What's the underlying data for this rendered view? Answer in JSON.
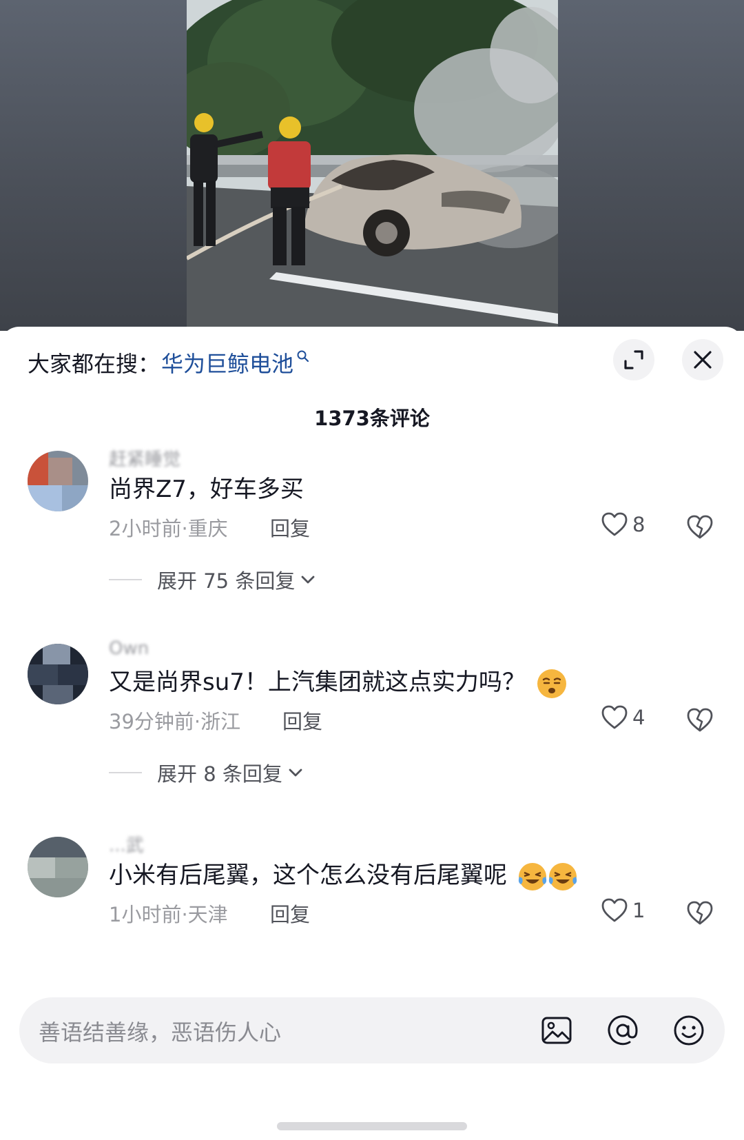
{
  "video": {
    "background_color": "#50555e"
  },
  "search": {
    "prefix": "大家都在搜：",
    "term": "华为巨鲸电池",
    "icon": "search-icon"
  },
  "header": {
    "expand_icon": "expand-icon",
    "close_icon": "close-icon"
  },
  "comments_count_title": "1373条评论",
  "comments": [
    {
      "username": "赶紧睡觉",
      "text": "尚界Z7，好车多买",
      "time_location": "2小时前·重庆",
      "reply_label": "回复",
      "likes": "8",
      "expand_label": "展开 75 条回复",
      "avatar_colors": [
        "#c9523a",
        "#7f8b99",
        "#a8c0e0"
      ]
    },
    {
      "username": "Own",
      "text": "又是尚界su7！上汽集团就这点实力吗？",
      "emoji": "smirk-emoji",
      "time_location": "39分钟前·浙江",
      "reply_label": "回复",
      "likes": "4",
      "expand_label": "展开 8 条回复",
      "avatar_colors": [
        "#1f2633",
        "#3a4557",
        "#8895a8"
      ]
    },
    {
      "username": "...武",
      "text": "小米有后尾翼，这个怎么没有后尾翼呢",
      "emoji": "laugh-cry-emoji",
      "time_location": "1小时前·天津",
      "reply_label": "回复",
      "likes": "1",
      "avatar_colors": [
        "#56606a",
        "#7e8a86",
        "#b8c0bd"
      ]
    }
  ],
  "input": {
    "placeholder": "善语结善缘，恶语伤人心",
    "icons": [
      "image-icon",
      "at-icon",
      "emoji-icon"
    ]
  },
  "colors": {
    "link_blue": "#1f4f9a",
    "text_primary": "#161823",
    "text_secondary": "#9a9ba0"
  }
}
